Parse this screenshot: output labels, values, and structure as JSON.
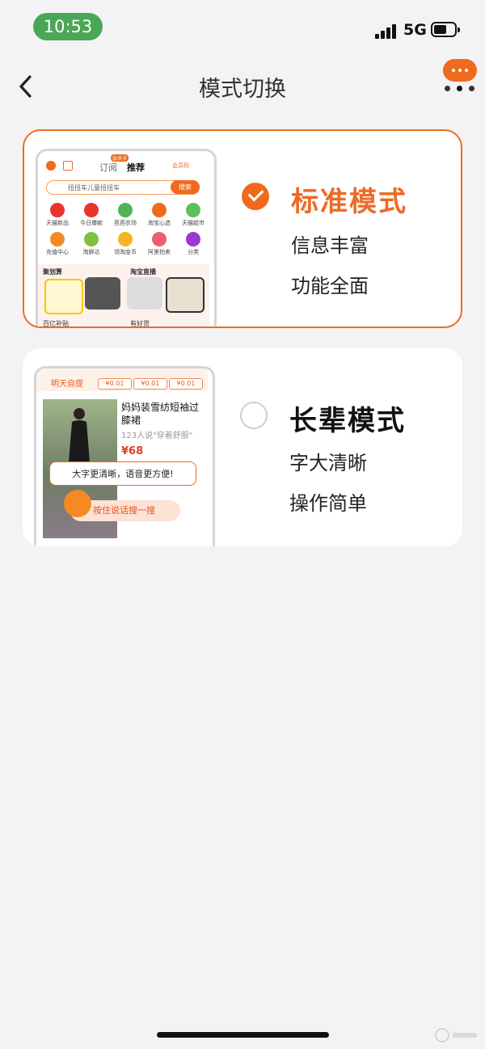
{
  "status_bar": {
    "time": "10:53",
    "network": "5G"
  },
  "nav": {
    "title": "模式切换",
    "back_icon": "chevron-left-icon",
    "more_icon": "more-bubble-icon"
  },
  "colors": {
    "accent": "#f06a1e",
    "accent_text": "#ee6a24",
    "background": "#f3f3f6",
    "time_pill": "#4aa755"
  },
  "modes": [
    {
      "title": "标准模式",
      "features": [
        "信息丰富",
        "功能全面"
      ],
      "selected": true,
      "preview": {
        "tabs": [
          "订阅",
          "推荐"
        ],
        "tab_badge": "会员卡",
        "member_code": "会员码",
        "search_placeholder": "扭扭车儿童扭扭车",
        "search_button": "搜索",
        "grid": [
          "天猫新品",
          "今日爆款",
          "芭芭农场",
          "淘宝心选",
          "天猫超市",
          "充值中心",
          "淘鲜达",
          "领淘金币",
          "阿里拍卖",
          "分类"
        ],
        "sections": [
          "聚划算",
          "淘宝直播",
          "百亿补贴",
          "有好货"
        ]
      }
    },
    {
      "title": "长辈模式",
      "features": [
        "字大清晰",
        "操作简单"
      ],
      "selected": false,
      "preview": {
        "header": "明天自提",
        "coupons": [
          "¥0.01",
          "¥0.01",
          "¥0.01"
        ],
        "product_name": "妈妈装雪纺短袖过膝裙",
        "product_sub": "123人说\"穿着舒服\"",
        "price": "¥68",
        "tip": "大字更清晰，语音更方便!",
        "voice_button": "按住说话搜一搜"
      }
    }
  ]
}
